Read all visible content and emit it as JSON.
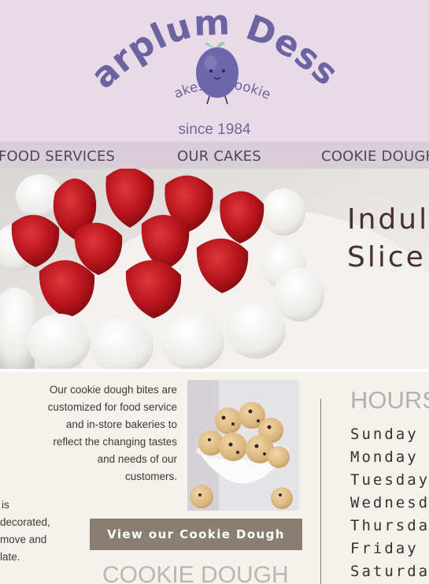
{
  "header": {
    "brand_name": "Sugarplum Desserts",
    "tagline": "Cakes & Cookies",
    "since": "since 1984"
  },
  "nav": {
    "items": [
      {
        "label": "FOOD SERVICES"
      },
      {
        "label": "OUR CAKES"
      },
      {
        "label": "COOKIE DOUGH"
      }
    ]
  },
  "hero": {
    "line1": "Indul",
    "line2": "Slice"
  },
  "cookie_section": {
    "description": [
      "Our cookie dough bites are",
      "customized for food service",
      "and in-store bakeries to",
      "reflect the changing tastes",
      "and needs of our",
      "customers."
    ],
    "left_fragment": [
      "is",
      "decorated,",
      "move and",
      "late."
    ],
    "button_label": "View our Cookie Dough",
    "heading": "COOKIE DOUGH"
  },
  "hours": {
    "title": "HOURS",
    "days": [
      "Sunday",
      "Monday",
      "Tuesday",
      "Wednesd",
      "Thursda",
      "Friday",
      "Saturda"
    ]
  },
  "colors": {
    "header_bg": "#e8dae6",
    "nav_bg": "#d8cdd8",
    "brand_purple": "#6b63a2",
    "button_bg": "#8a7e73",
    "content_bg": "#f5f2ec"
  }
}
